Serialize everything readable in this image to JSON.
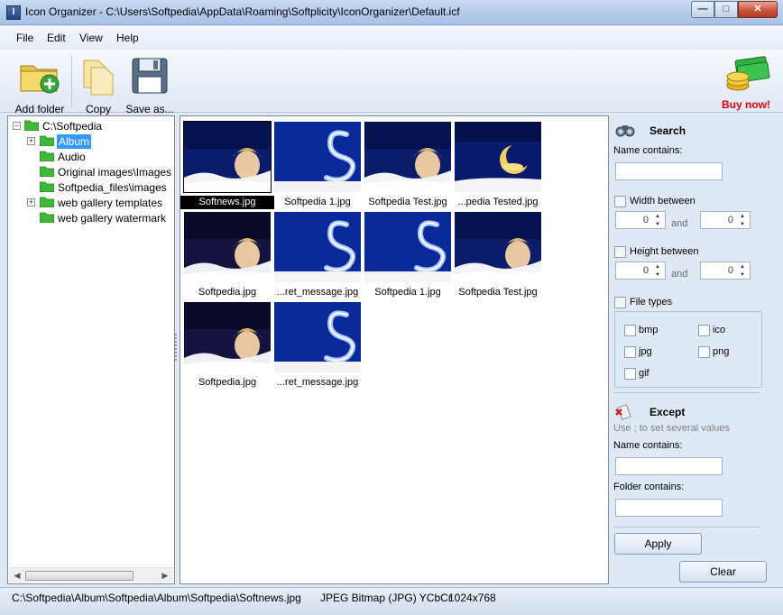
{
  "window": {
    "title": "Icon Organizer - C:\\Users\\Softpedia\\AppData\\Roaming\\Softplicity\\IconOrganizer\\Default.icf"
  },
  "menu": [
    "File",
    "Edit",
    "View",
    "Help"
  ],
  "toolbar": {
    "add_folder": "Add folder",
    "copy": "Copy",
    "save_as": "Save as...",
    "buy_now": "Buy now!"
  },
  "tree": {
    "root": "C:\\Softpedia",
    "items": [
      "Album",
      "Audio",
      "Original images\\Images wit",
      "Softpedia_files\\images",
      "web gallery templates",
      "web gallery watermark"
    ]
  },
  "thumbnails": [
    {
      "caption": "Softnews.jpg",
      "selected": true,
      "style": "portrait"
    },
    {
      "caption": "Softpedia 1.jpg",
      "style": "s-logo"
    },
    {
      "caption": "Softpedia Test.jpg",
      "style": "portrait"
    },
    {
      "caption": "...pedia Tested.jpg",
      "style": "moon"
    },
    {
      "caption": "Softpedia.jpg",
      "style": "portrait-dark"
    },
    {
      "caption": "...ret_message.jpg",
      "style": "s-logo"
    },
    {
      "caption": "Softpedia 1.jpg",
      "style": "s-logo"
    },
    {
      "caption": "Softpedia Test.jpg",
      "style": "portrait"
    },
    {
      "caption": "Softpedia.jpg",
      "style": "portrait-dark"
    },
    {
      "caption": "...ret_message.jpg",
      "style": "s-logo"
    }
  ],
  "search": {
    "title": "Search",
    "name_contains": "Name contains:",
    "width_between": "Width between",
    "height_between": "Height between",
    "and": "and",
    "width_min": "0",
    "width_max": "0",
    "height_min": "0",
    "height_max": "0",
    "file_types": "File types",
    "types": [
      "bmp",
      "ico",
      "jpg",
      "png",
      "gif"
    ]
  },
  "except": {
    "title": "Except",
    "hint": "Use ; to set several values",
    "name_contains": "Name contains:",
    "folder_contains": "Folder contains:"
  },
  "buttons": {
    "apply": "Apply",
    "clear": "Clear"
  },
  "status": {
    "path": "C:\\Softpedia\\Album\\Softpedia\\Album\\Softpedia\\Softnews.jpg",
    "format": "JPEG Bitmap (JPG) YCbCr",
    "size": "1024x768"
  },
  "colors": {
    "buy_now": "#e00000",
    "selection": "#3399ff",
    "thumb_bg": "#0a1c6a"
  }
}
